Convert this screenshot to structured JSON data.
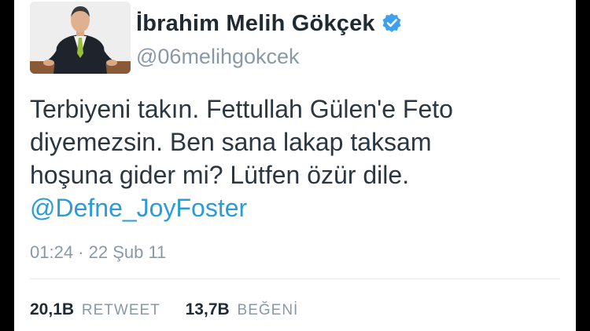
{
  "tweet": {
    "author": {
      "display_name": "İbrahim Melih Gökçek",
      "handle": "@06melihgokcek",
      "verified": true,
      "verified_icon": "verified-badge-icon",
      "verified_color": "#3ea1ec"
    },
    "text_lines": [
      "Terbiyeni takın. Fettullah Gülen'e Feto",
      "diyemezsin. Ben sana lakap taksam",
      "hoşuna gider mi? Lütfen özür dile."
    ],
    "mention": "@Defne_JoyFoster",
    "timestamp": "01:24 · 22 Şub 11",
    "stats": {
      "retweet_count": "20,1B",
      "retweet_label": "RETWEET",
      "like_count": "13,7B",
      "like_label": "BEĞENİ"
    }
  },
  "colors": {
    "mention": "#2b9cd8",
    "secondary_text": "#8899a6",
    "primary_text": "#2a3640",
    "background": "#ffffff"
  }
}
